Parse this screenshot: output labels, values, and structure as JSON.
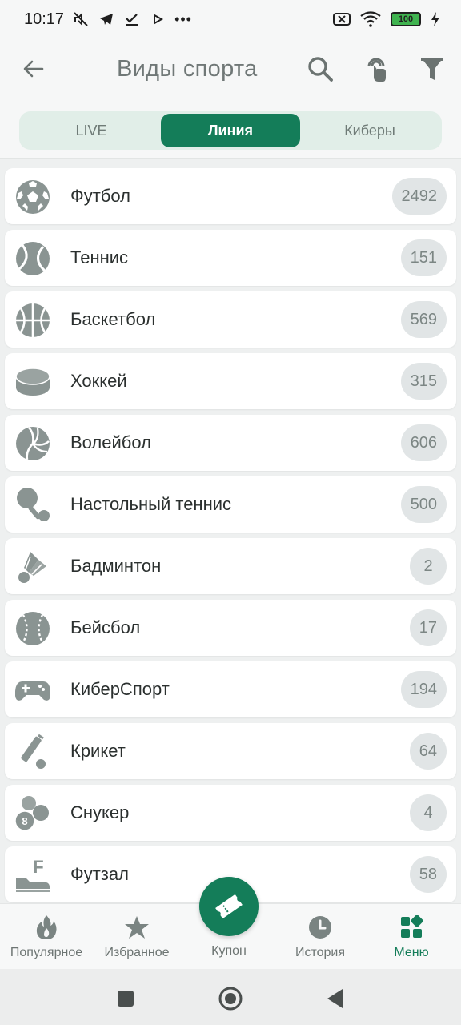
{
  "status_bar": {
    "time": "10:17",
    "dots": "•••",
    "battery": "100",
    "icons": [
      "mute-icon",
      "telegram-icon",
      "check-icon",
      "play-icon",
      "sim-off-icon",
      "wifi-icon",
      "battery-icon",
      "charging-icon"
    ]
  },
  "header": {
    "title": "Виды спорта",
    "icons": [
      "back-arrow-icon",
      "search-icon",
      "touch-icon",
      "filter-icon"
    ]
  },
  "tabs": [
    {
      "label": "LIVE",
      "active": false
    },
    {
      "label": "Линия",
      "active": true
    },
    {
      "label": "Киберы",
      "active": false
    }
  ],
  "sports": [
    {
      "name": "Футбол",
      "count": "2492",
      "icon": "soccer-ball-icon"
    },
    {
      "name": "Теннис",
      "count": "151",
      "icon": "tennis-ball-icon"
    },
    {
      "name": "Баскетбол",
      "count": "569",
      "icon": "basketball-icon"
    },
    {
      "name": "Хоккей",
      "count": "315",
      "icon": "hockey-puck-icon"
    },
    {
      "name": "Волейбол",
      "count": "606",
      "icon": "volleyball-icon"
    },
    {
      "name": "Настольный теннис",
      "count": "500",
      "icon": "table-tennis-icon"
    },
    {
      "name": "Бадминтон",
      "count": "2",
      "icon": "shuttlecock-icon"
    },
    {
      "name": "Бейсбол",
      "count": "17",
      "icon": "baseball-icon"
    },
    {
      "name": "КиберСпорт",
      "count": "194",
      "icon": "gamepad-icon"
    },
    {
      "name": "Крикет",
      "count": "64",
      "icon": "cricket-icon"
    },
    {
      "name": "Снукер",
      "count": "4",
      "icon": "snooker-icon"
    },
    {
      "name": "Футзал",
      "count": "58",
      "icon": "futsal-icon"
    }
  ],
  "bottom_nav": {
    "popular": "Популярное",
    "favorites": "Избранное",
    "coupon": "Купон",
    "history": "История",
    "menu": "Меню"
  },
  "colors": {
    "accent": "#147d59",
    "icon_gray": "#8a9492",
    "badge_bg": "#e1e5e6"
  }
}
